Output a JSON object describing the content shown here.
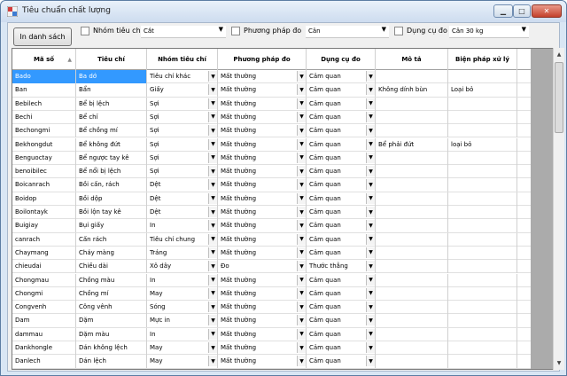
{
  "window": {
    "title": "Tiêu chuẩn chất lượng",
    "minimize": "▁",
    "maximize": "□",
    "close": "✕"
  },
  "toolbar": {
    "print_label": "In danh sách",
    "filters": [
      {
        "label": "Nhóm tiêu chí",
        "value": "Cắt"
      },
      {
        "label": "Phương pháp đo",
        "value": "Cân"
      },
      {
        "label": "Dụng cụ đo",
        "value": "Cân 30 kg"
      }
    ]
  },
  "grid": {
    "columns": [
      "Mã số",
      "Tiêu chí",
      "Nhóm tiêu chí",
      "Phương pháp đo",
      "Dụng cụ đo",
      "Mô tả",
      "Biện pháp xử lý"
    ],
    "rows": [
      {
        "ma": "Bado",
        "tc": "Ba dớ",
        "nhom": "Tiêu chí khác",
        "pp": "Mất thường",
        "dc": "Cảm quan",
        "mt": "",
        "bp": "",
        "selected": true
      },
      {
        "ma": "Ban",
        "tc": "Bẩn",
        "nhom": "Giấy",
        "pp": "Mất thường",
        "dc": "Cảm quan",
        "mt": "Không dính bùn",
        "bp": "Loại bỏ"
      },
      {
        "ma": "Bebilech",
        "tc": "Bể bị lệch",
        "nhom": "Sợi",
        "pp": "Mất thường",
        "dc": "Cảm quan",
        "mt": "",
        "bp": ""
      },
      {
        "ma": "Bechi",
        "tc": "Bể chỉ",
        "nhom": "Sợi",
        "pp": "Mất thường",
        "dc": "Cảm quan",
        "mt": "",
        "bp": ""
      },
      {
        "ma": "Bechongmi",
        "tc": "Bể chồng mí",
        "nhom": "Sợi",
        "pp": "Mất thường",
        "dc": "Cảm quan",
        "mt": "",
        "bp": ""
      },
      {
        "ma": "Bekhongdut",
        "tc": "Bể không đứt",
        "nhom": "Sợi",
        "pp": "Mất thường",
        "dc": "Cảm quan",
        "mt": "Bể phải đứt",
        "bp": "loại bỏ"
      },
      {
        "ma": "Benguoctay",
        "tc": "Bể ngược tay kê",
        "nhom": "Sợi",
        "pp": "Mất thường",
        "dc": "Cảm quan",
        "mt": "",
        "bp": ""
      },
      {
        "ma": "benoibilec",
        "tc": "Bể nổi bị lệch",
        "nhom": "Sợi",
        "pp": "Mất thường",
        "dc": "Cảm quan",
        "mt": "",
        "bp": ""
      },
      {
        "ma": "Boicanrach",
        "tc": "Bồi cấn, rách",
        "nhom": "Dệt",
        "pp": "Mất thường",
        "dc": "Cảm quan",
        "mt": "",
        "bp": ""
      },
      {
        "ma": "Boidop",
        "tc": "Bồi dộp",
        "nhom": "Dệt",
        "pp": "Mất thường",
        "dc": "Cảm quan",
        "mt": "",
        "bp": ""
      },
      {
        "ma": "Boilontayk",
        "tc": "Bồi lộn tay kê",
        "nhom": "Dệt",
        "pp": "Mất thường",
        "dc": "Cảm quan",
        "mt": "",
        "bp": ""
      },
      {
        "ma": "Buigiay",
        "tc": "Bụi giấy",
        "nhom": "In",
        "pp": "Mất thường",
        "dc": "Cảm quan",
        "mt": "",
        "bp": ""
      },
      {
        "ma": "canrach",
        "tc": "Cấn rách",
        "nhom": "Tiêu chí chung",
        "pp": "Mất thường",
        "dc": "Cảm quan",
        "mt": "",
        "bp": ""
      },
      {
        "ma": "Chaymang",
        "tc": "Cháy màng",
        "nhom": "Tráng",
        "pp": "Mất thường",
        "dc": "Cảm quan",
        "mt": "",
        "bp": ""
      },
      {
        "ma": "chieudai",
        "tc": "Chiều dài",
        "nhom": "Xô dây",
        "pp": "Đo",
        "dc": "Thước thẳng",
        "mt": "",
        "bp": ""
      },
      {
        "ma": "Chongmau",
        "tc": "Chồng màu",
        "nhom": "In",
        "pp": "Mất thường",
        "dc": "Cảm quan",
        "mt": "",
        "bp": ""
      },
      {
        "ma": "Chongmi",
        "tc": "Chồng mí",
        "nhom": "May",
        "pp": "Mất thường",
        "dc": "Cảm quan",
        "mt": "",
        "bp": ""
      },
      {
        "ma": "Congvenh",
        "tc": " Công vênh",
        "nhom": "Sóng",
        "pp": "Mất thường",
        "dc": "Cảm quan",
        "mt": "",
        "bp": ""
      },
      {
        "ma": "Dam",
        "tc": "Dặm",
        "nhom": "Mực in",
        "pp": "Mất thường",
        "dc": "Cảm quan",
        "mt": "",
        "bp": ""
      },
      {
        "ma": "dammau",
        "tc": "Dặm màu",
        "nhom": "In",
        "pp": "Mất thường",
        "dc": "Cảm quan",
        "mt": "",
        "bp": ""
      },
      {
        "ma": "Dankhongle",
        "tc": "Dán không lệch",
        "nhom": "May",
        "pp": "Mất thường",
        "dc": "Cảm quan",
        "mt": "",
        "bp": ""
      },
      {
        "ma": "Danlech",
        "tc": "Dán lệch",
        "nhom": "May",
        "pp": "Mất thường",
        "dc": "Cảm quan",
        "mt": "",
        "bp": ""
      }
    ]
  },
  "icons": {
    "dropdown": "▼",
    "sort": "▲",
    "scroll_up": "▲",
    "scroll_down": "▼"
  }
}
